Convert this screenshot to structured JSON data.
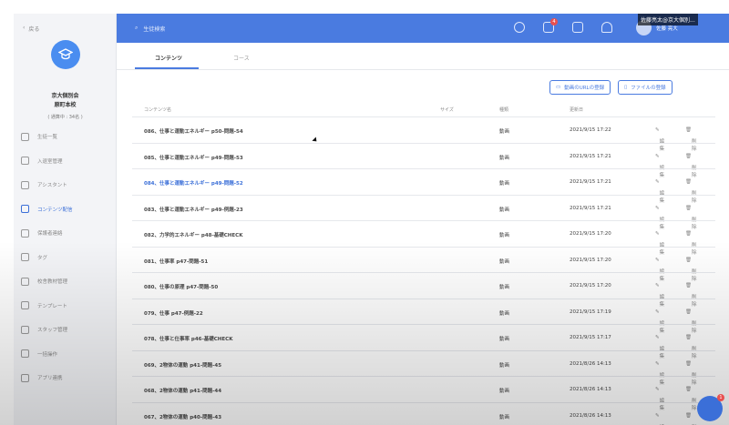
{
  "sidebar": {
    "back_label": "戻る",
    "school_name_1": "京大個別会",
    "school_name_2": "原町本校",
    "school_sub": "( 通算中 : 34名 )",
    "items": [
      {
        "label": "生徒一覧",
        "icon": "person-icon"
      },
      {
        "label": "入退室管理",
        "icon": "door-icon"
      },
      {
        "label": "アシスタント",
        "icon": "assistant-icon"
      },
      {
        "label": "コンテンツ配信",
        "icon": "monitor-icon",
        "active": true
      },
      {
        "label": "保護者連絡",
        "icon": "people-icon"
      },
      {
        "label": "タグ",
        "icon": "tag-icon"
      },
      {
        "label": "校舎教材管理",
        "icon": "book-icon"
      },
      {
        "label": "テンプレート",
        "icon": "template-icon"
      },
      {
        "label": "スタッフ管理",
        "icon": "staff-icon"
      },
      {
        "label": "一括操作",
        "icon": "batch-icon"
      },
      {
        "label": "アプリ連携",
        "icon": "app-icon"
      }
    ]
  },
  "topbar": {
    "search_placeholder": "生徒検索",
    "notification_count": "4",
    "user_name": "佐藤 亮大",
    "overlay_text": "佐藤亮太@京大個別..."
  },
  "tabs": [
    {
      "label": "コンテンツ",
      "active": true
    },
    {
      "label": "コース",
      "active": false
    }
  ],
  "actions": {
    "add_video_url": "動画のURLの登録",
    "add_file": "ファイルの登録"
  },
  "table": {
    "headers": {
      "name": "コンテンツ名",
      "size": "サイズ",
      "type": "種類",
      "updated": "更新日"
    },
    "edit_label": "編集",
    "delete_label": "削除",
    "rows": [
      {
        "name": "086、仕事と運動エネルギー p50-問題-54",
        "type": "動画",
        "date": "2021/9/15 17:22"
      },
      {
        "name": "085、仕事と運動エネルギー p49-問題-53",
        "type": "動画",
        "date": "2021/9/15 17:21"
      },
      {
        "name": "084、仕事と運動エネルギー p49-問題-52",
        "type": "動画",
        "date": "2021/9/15 17:21",
        "highlight": true
      },
      {
        "name": "083、仕事と運動エネルギー p49-例題-23",
        "type": "動画",
        "date": "2021/9/15 17:21"
      },
      {
        "name": "082、力学的エネルギー p48-基礎CHECK",
        "type": "動画",
        "date": "2021/9/15 17:20"
      },
      {
        "name": "081、仕事率 p47-問題-51",
        "type": "動画",
        "date": "2021/9/15 17:20"
      },
      {
        "name": "080、仕事の原理 p47-問題-50",
        "type": "動画",
        "date": "2021/9/15 17:20"
      },
      {
        "name": "079、仕事 p47-例題-22",
        "type": "動画",
        "date": "2021/9/15 17:19"
      },
      {
        "name": "078、仕事と仕事率 p46-基礎CHECK",
        "type": "動画",
        "date": "2021/9/15 17:17"
      },
      {
        "name": "069、2物体の運動 p41-問題-45",
        "type": "動画",
        "date": "2021/8/26 14:13"
      },
      {
        "name": "068、2物体の運動 p41-問題-44",
        "type": "動画",
        "date": "2021/8/26 14:13"
      },
      {
        "name": "067、2物体の運動 p40-問題-43",
        "type": "動画",
        "date": "2021/8/26 14:13"
      }
    ]
  },
  "chat": {
    "badge": "1"
  },
  "colors": {
    "accent": "#4a7be0",
    "sidebar_bg": "#f3f4f7",
    "badge": "#e85050"
  }
}
